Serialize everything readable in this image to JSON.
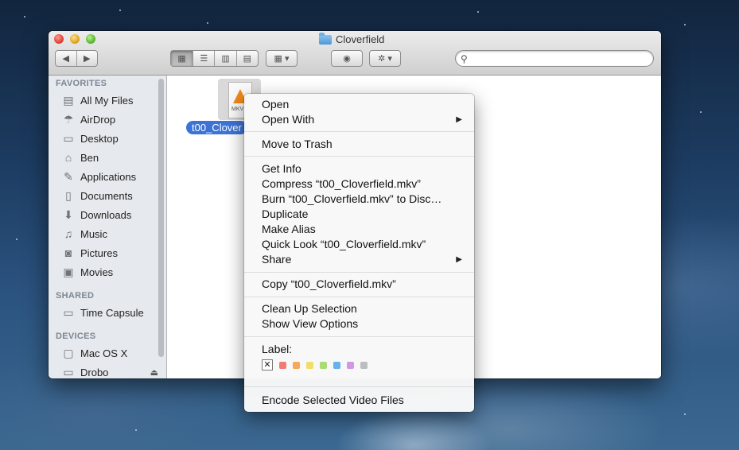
{
  "window": {
    "title": "Cloverfield"
  },
  "search": {
    "placeholder": "",
    "value": ""
  },
  "sidebar": {
    "sections": [
      {
        "header": "FAVORITES",
        "items": [
          {
            "label": "All My Files",
            "icon": "all-files-icon"
          },
          {
            "label": "AirDrop",
            "icon": "airdrop-icon"
          },
          {
            "label": "Desktop",
            "icon": "desktop-icon"
          },
          {
            "label": "Ben",
            "icon": "home-icon"
          },
          {
            "label": "Applications",
            "icon": "applications-icon"
          },
          {
            "label": "Documents",
            "icon": "documents-icon"
          },
          {
            "label": "Downloads",
            "icon": "downloads-icon"
          },
          {
            "label": "Music",
            "icon": "music-icon"
          },
          {
            "label": "Pictures",
            "icon": "pictures-icon"
          },
          {
            "label": "Movies",
            "icon": "movies-icon"
          }
        ]
      },
      {
        "header": "SHARED",
        "items": [
          {
            "label": "Time Capsule",
            "icon": "time-capsule-icon"
          }
        ]
      },
      {
        "header": "DEVICES",
        "items": [
          {
            "label": "Mac OS X",
            "icon": "disk-icon"
          },
          {
            "label": "Drobo",
            "icon": "drive-icon"
          }
        ]
      }
    ]
  },
  "file": {
    "label": "t00_Clover",
    "badge": "MKV"
  },
  "context_menu": {
    "items": [
      "Open",
      "Open With",
      "Move to Trash",
      "Get Info",
      "Compress “t00_Cloverfield.mkv”",
      "Burn “t00_Cloverfield.mkv” to Disc…",
      "Duplicate",
      "Make Alias",
      "Quick Look “t00_Cloverfield.mkv”",
      "Share",
      "Copy “t00_Cloverfield.mkv”",
      "Clean Up Selection",
      "Show View Options",
      "Label:",
      "Encode Selected Video Files"
    ],
    "label_colors": [
      "#f07c72",
      "#f5a95a",
      "#f1de6a",
      "#a9dc72",
      "#67b2ea",
      "#cf9ae0",
      "#bdbdbd"
    ],
    "no_label_mark": "✕"
  }
}
